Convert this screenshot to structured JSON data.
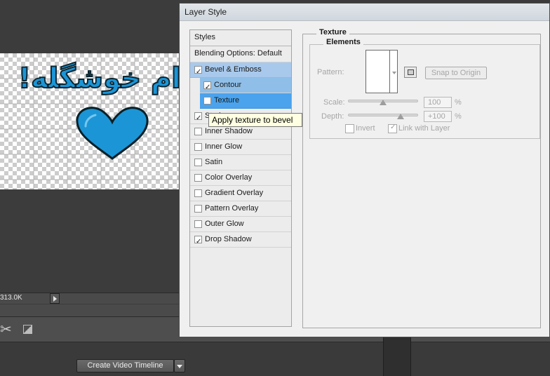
{
  "canvas": {
    "text": "ام خوشگله!",
    "heart_color": "#1b95d6"
  },
  "status": {
    "size_text": "313.0K"
  },
  "timeline": {
    "create_button": "Create Video Timeline"
  },
  "dialog": {
    "title": "Layer Style",
    "styles_header": "Styles",
    "blending_options": "Blending Options: Default",
    "effects": [
      {
        "label": "Bevel & Emboss",
        "checked": true
      },
      {
        "label": "Contour",
        "checked": true
      },
      {
        "label": "Texture",
        "checked": false
      },
      {
        "label": "Stroke",
        "checked": true
      },
      {
        "label": "Inner Shadow",
        "checked": false
      },
      {
        "label": "Inner Glow",
        "checked": false
      },
      {
        "label": "Satin",
        "checked": false
      },
      {
        "label": "Color Overlay",
        "checked": false
      },
      {
        "label": "Gradient Overlay",
        "checked": false
      },
      {
        "label": "Pattern Overlay",
        "checked": false
      },
      {
        "label": "Outer Glow",
        "checked": false
      },
      {
        "label": "Drop Shadow",
        "checked": true
      }
    ],
    "tooltip": "Apply texture to bevel",
    "texture": {
      "group_title": "Texture",
      "elements_title": "Elements",
      "pattern_label": "Pattern:",
      "snap_button": "Snap to Origin",
      "scale_label": "Scale:",
      "scale_value": "100",
      "scale_unit": "%",
      "scale_level": 100,
      "depth_label": "Depth:",
      "depth_value": "+100",
      "depth_unit": "%",
      "depth_level": 100,
      "invert_label": "Invert",
      "invert_checked": false,
      "link_label": "Link with Layer",
      "link_checked": true
    }
  },
  "colors": {
    "selection": "#4aa3ec",
    "selection_light": "#a8c9ec",
    "tooltip_bg": "#ffffe1"
  }
}
